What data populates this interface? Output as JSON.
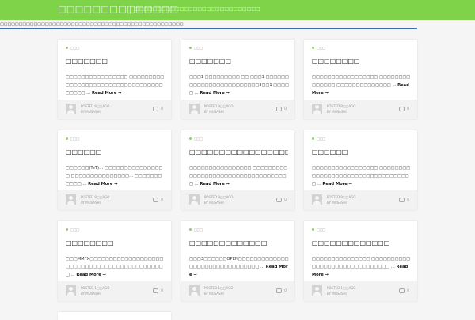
{
  "header": {
    "title": "□□□□□□□□□□□□□□",
    "description": "□□□□□□□□□□□□□□□□□□□□□□□□□□□□"
  },
  "breadcrumb": "□□□□□□□□□□□□□□□□□□□□□□□□□□□□□□□□□□□□□□□□□□□□□□□□□",
  "posts": [
    {
      "category": "□□□",
      "title": "□□□□□□□",
      "excerpt": "□□□□□□□□□□□□□□□□ □□□□□□□□□□□□□□□□□□□□□□□□□□□□□□□□□□□□□□□ …",
      "read_more": "Read More →",
      "posted": "POSTED 9□□AGO",
      "by": "BY MUSASHI",
      "comments": "0"
    },
    {
      "category": "□□□",
      "title": "□□□□□□□",
      "excerpt": "□□□1 □□□□□□□□□ □□ □□□1 □□□□□□□□□□□□□□□□□□□□□□□□3□□1 □□□□□ …",
      "read_more": "Read More →",
      "posted": "POSTED 9□□AGO",
      "by": "BY MUSASHI",
      "comments": "0"
    },
    {
      "category": "□□□",
      "title": "□□□□□□□□",
      "excerpt": "□□□□□□□□□□□□□□□□□ □□□□□□□□□□□□□□ □□□□□□□□□□□□□□ …",
      "read_more": "Read More →",
      "posted": "POSTED 9□□AGO",
      "by": "BY MUSASHI",
      "comments": "0"
    },
    {
      "category": "□□□",
      "title": "□□□□□□",
      "excerpt": "□□□□□□(ToT)… □□□□□□□□□□□□□□□□ □□□□□□□□□□□□□□□… □□□□□□□□□□□ …",
      "read_more": "Read More →",
      "posted": "POSTED 9□□AGO",
      "by": "BY MUSASHI",
      "comments": "0"
    },
    {
      "category": "□□□",
      "title": "□□□□□□□□□□□□□□□□□",
      "excerpt": "□□□□□□□□□□□□□□□□ □□□□□□□□□□□□□□□□□□□□□□□□□□□□□□□□□□□ …",
      "read_more": "Read More →",
      "posted": "POSTED 9□□AGO",
      "by": "BY MUSASHI",
      "comments": "0"
    },
    {
      "category": "□□□",
      "title": "□□□□□□",
      "excerpt": "□□□□□□□□□□□□□□□□□ □□□□□□□□□□□□□□□□□□□□□□□□□□□□□□□□□□ …",
      "read_more": "Read More →",
      "posted": "POSTED 9□□AGO",
      "by": "BY MUSASHI",
      "comments": "0"
    },
    {
      "category": "□□□",
      "title": "□□□□□□□□",
      "excerpt": "□□□MMFX□□□□□□□□□□□□□□□□□□□ □□□□□□□□□□□□□□□□□□□□□□□□□□ …",
      "read_more": "Read More →",
      "posted": "POSTED 1□□AGO",
      "by": "BY MUSASHI",
      "comments": "0"
    },
    {
      "category": "□□□",
      "title": "□□□□□□□□□□□□□",
      "excerpt": "□□□3□□□□□□OPEN□□□□□□□□□□□□□□□□□□□□□□□□□□□□□□□ …",
      "read_more": "Read More →",
      "posted": "POSTED 1□□AGO",
      "by": "BY MUSASHI",
      "comments": "0"
    },
    {
      "category": "□□□",
      "title": "□□□□□□□□□□□□□",
      "excerpt": "□□□□□□□□□□□□□□□ □□□□□□□□□□□□□□□□□□□□□□□□□□□□□□ …",
      "read_more": "Read More →",
      "posted": "POSTED 1□□AGO",
      "by": "BY MUSASHI",
      "comments": "0"
    }
  ]
}
